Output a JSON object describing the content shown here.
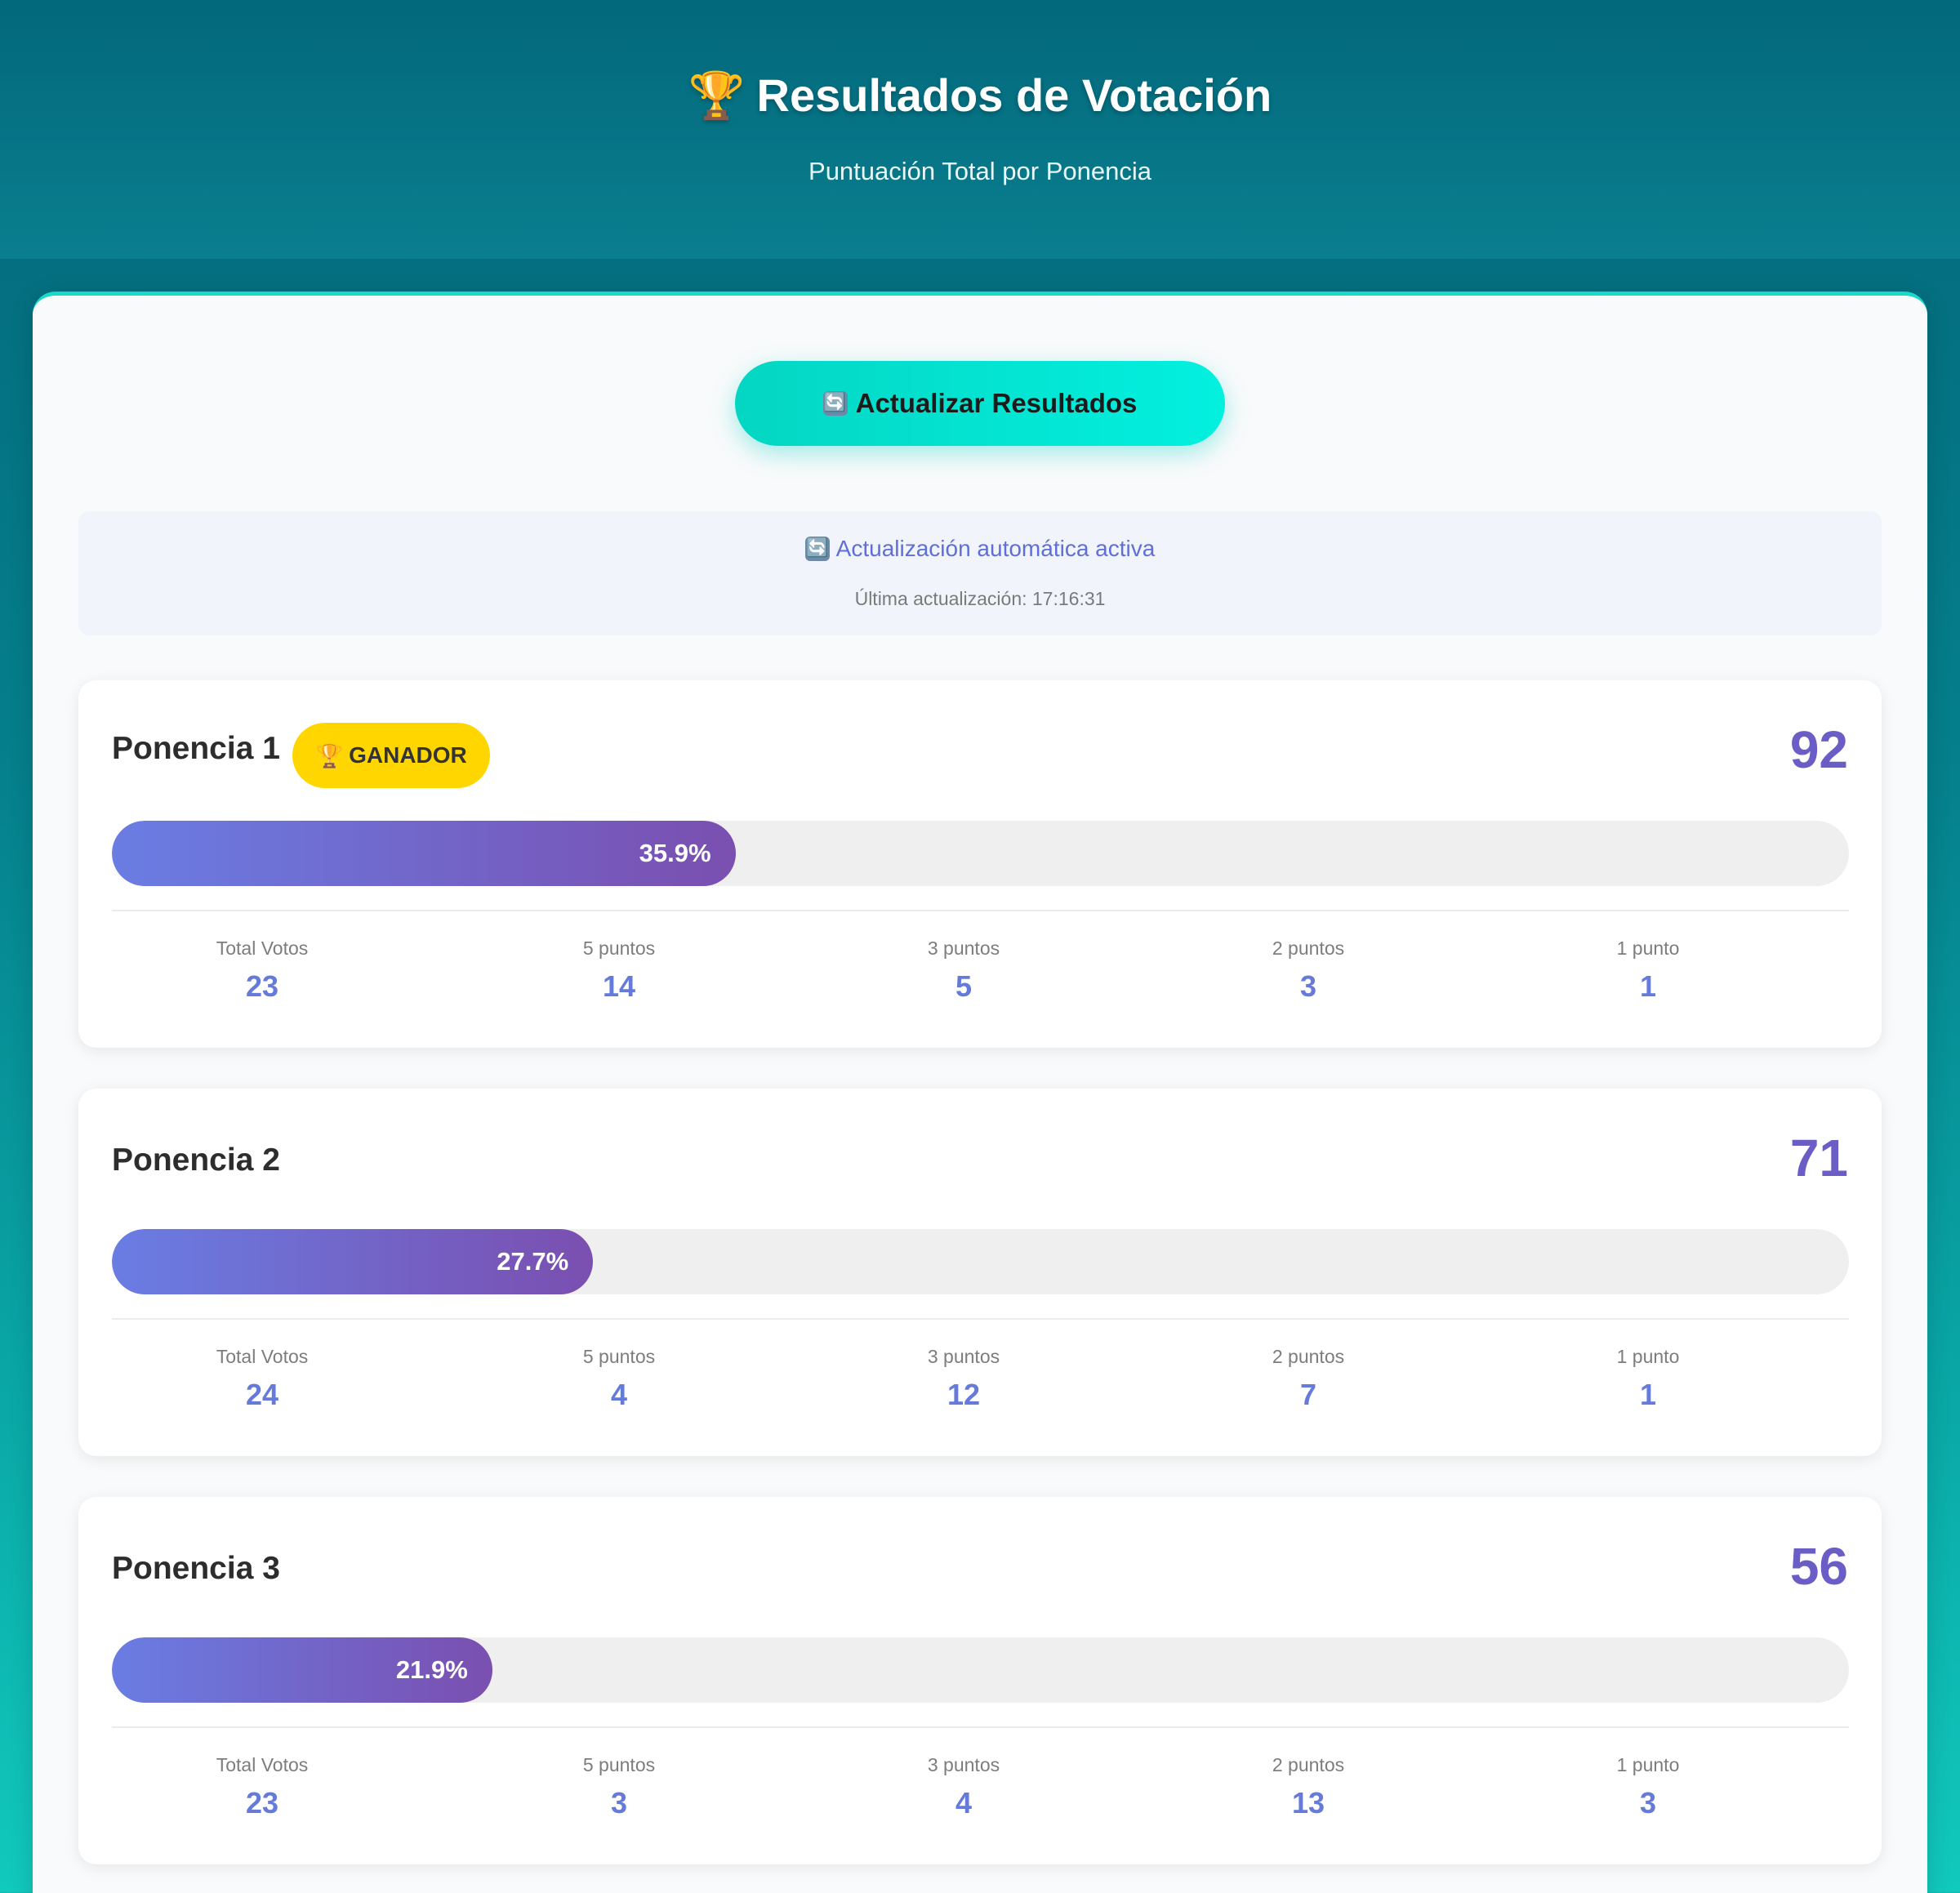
{
  "header": {
    "title": "Resultados de Votación",
    "trophy_icon": "🏆",
    "subtitle": "Puntuación Total por Ponencia"
  },
  "refresh_button": {
    "icon": "🔄",
    "label": "Actualizar Resultados"
  },
  "auto_update": {
    "icon": "🔄",
    "text": "Actualización automática activa",
    "last_update": "Última actualización: 17:16:31"
  },
  "winner_badge": {
    "icon": "🏆",
    "label": "GANADOR"
  },
  "stat_labels": {
    "total": "Total Votos",
    "five": "5 puntos",
    "three": "3 puntos",
    "two": "2 puntos",
    "one": "1 punto"
  },
  "ponencias": [
    {
      "name": "Ponencia 1",
      "score": "92",
      "percent": 35.9,
      "percent_label": "35.9%",
      "winner": true,
      "total": "23",
      "five": "14",
      "three": "5",
      "two": "3",
      "one": "1"
    },
    {
      "name": "Ponencia 2",
      "score": "71",
      "percent": 27.7,
      "percent_label": "27.7%",
      "winner": false,
      "total": "24",
      "five": "4",
      "three": "12",
      "two": "7",
      "one": "1"
    },
    {
      "name": "Ponencia 3",
      "score": "56",
      "percent": 21.9,
      "percent_label": "21.9%",
      "winner": false,
      "total": "23",
      "five": "3",
      "three": "4",
      "two": "13",
      "one": "3"
    }
  ],
  "colors": {
    "accent": "#6b5dc6",
    "stat_value": "#667ad9",
    "button": "#03e2d0",
    "badge": "#ffd600"
  }
}
